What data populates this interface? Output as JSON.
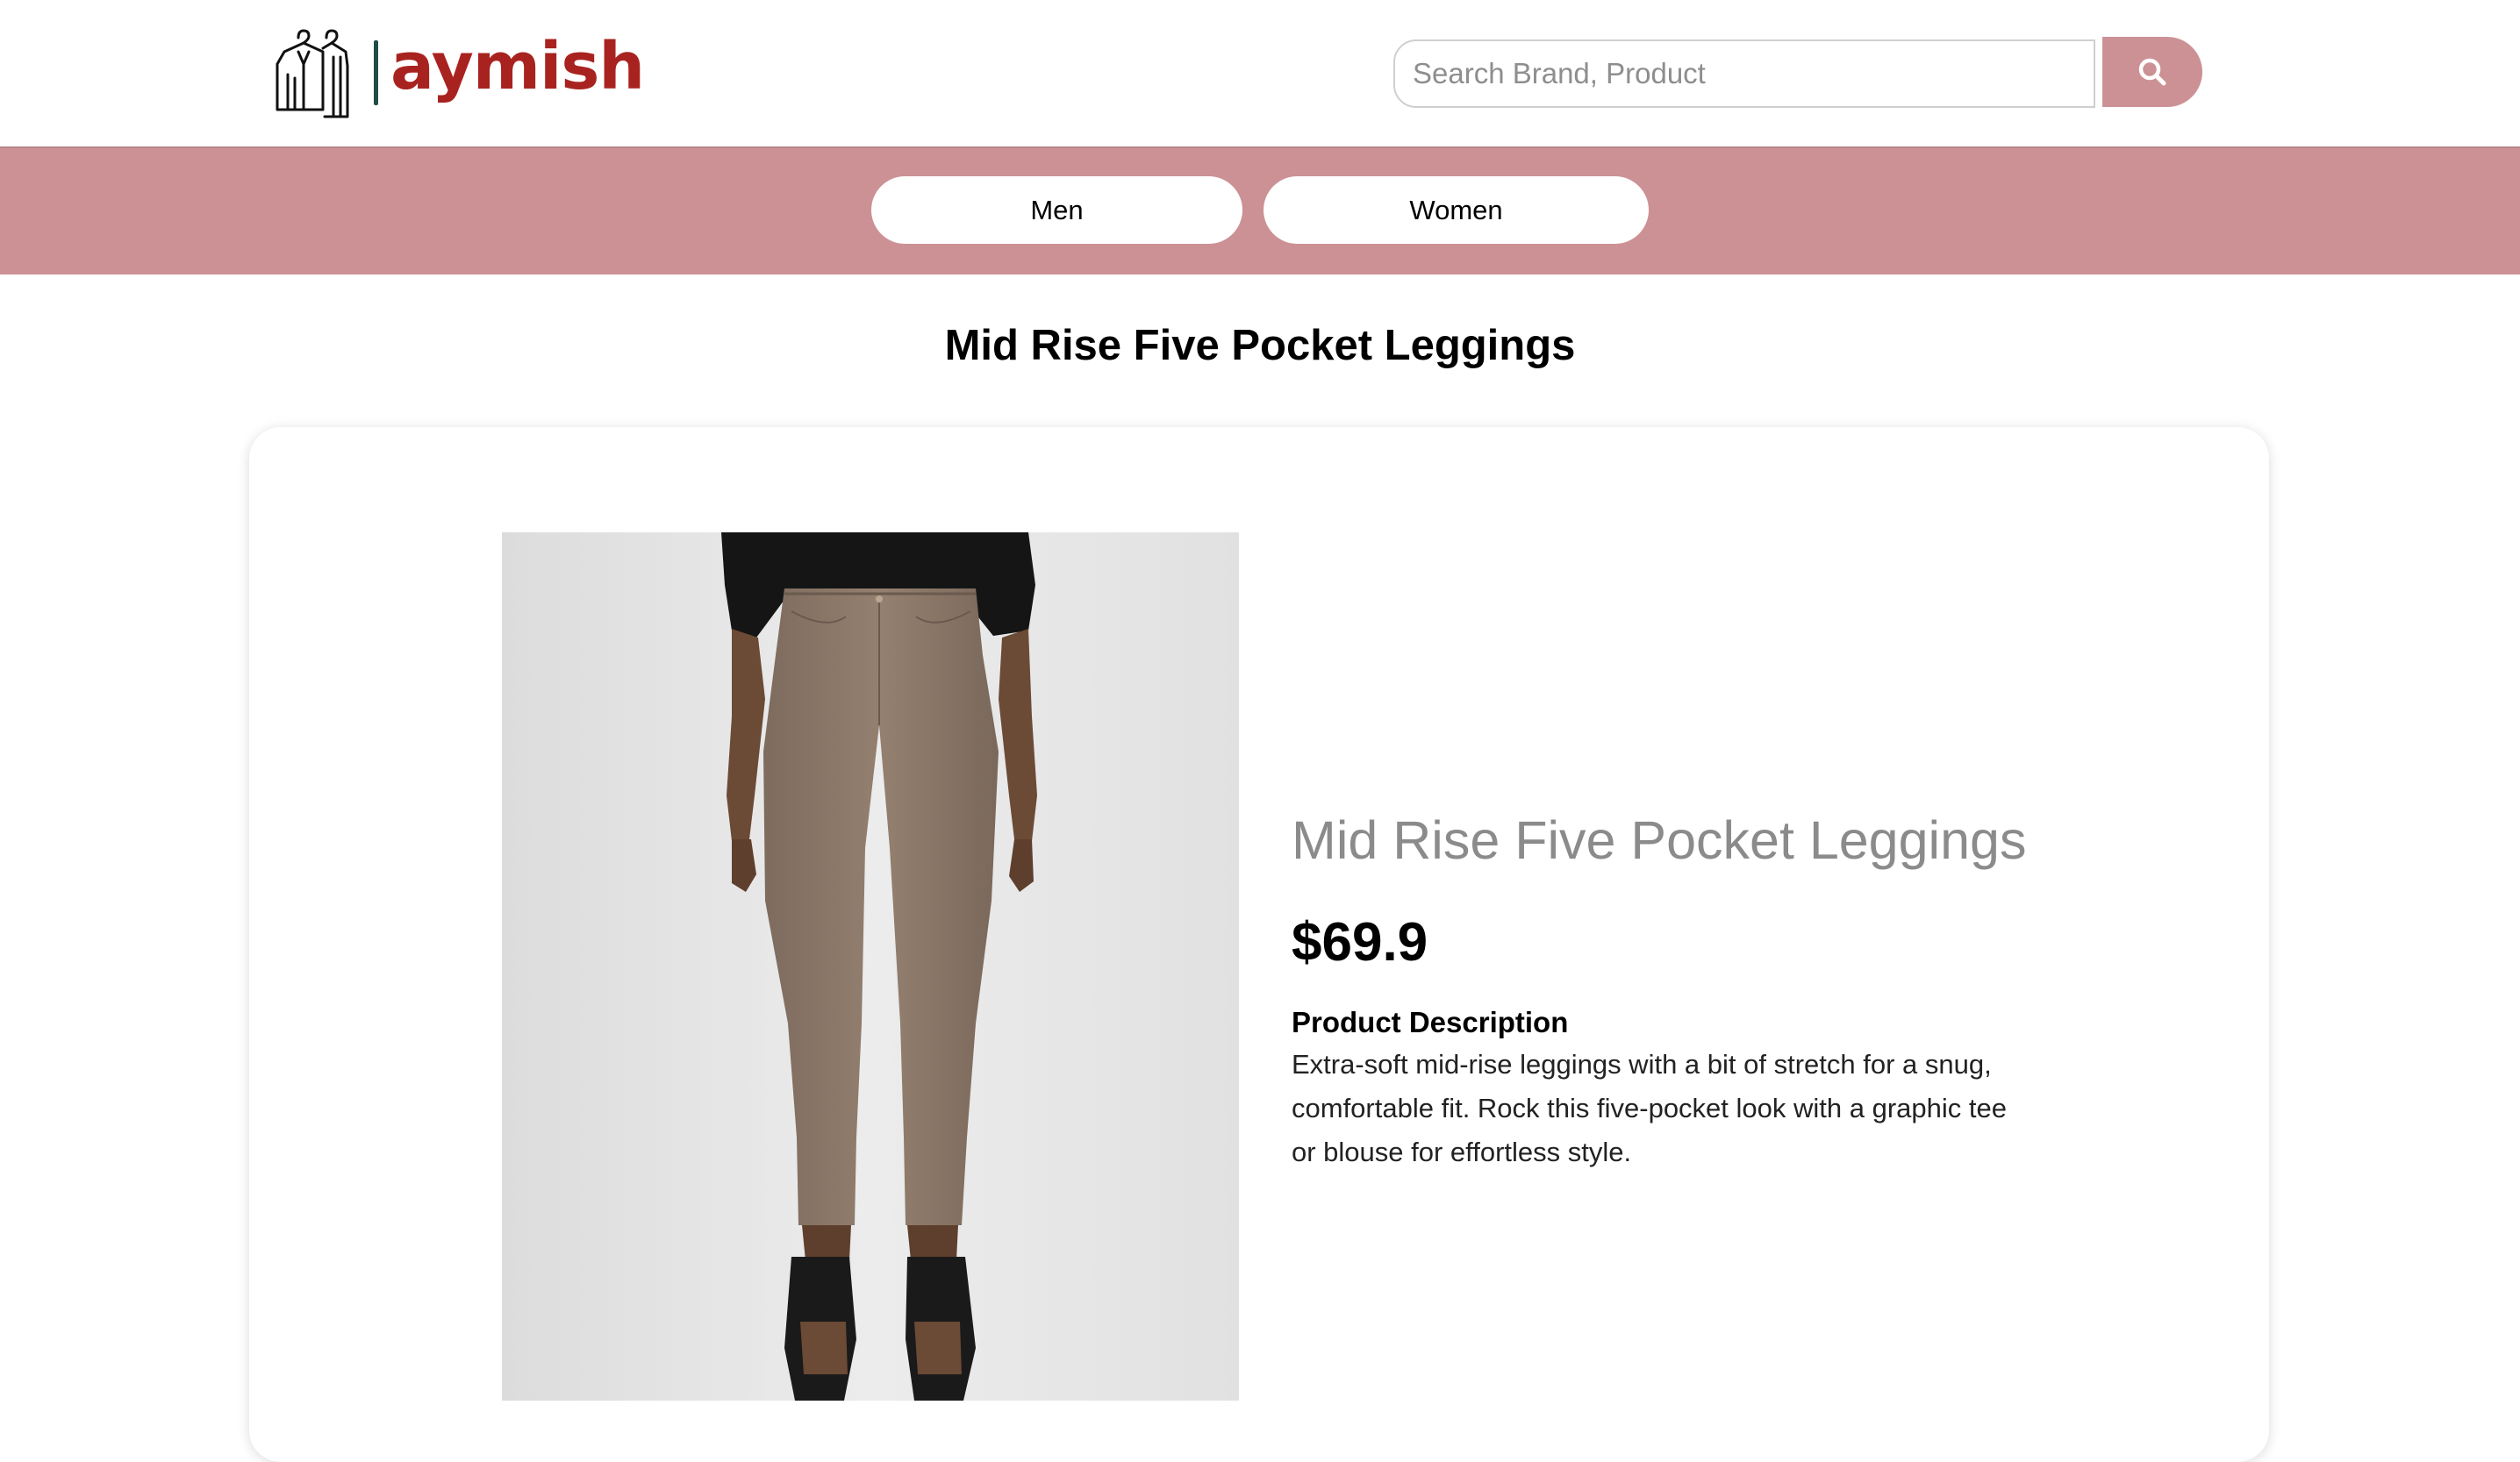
{
  "brand": {
    "name": "aymish",
    "color": "#a8231f"
  },
  "search": {
    "placeholder": "Search Brand, Product",
    "icon": "search-icon"
  },
  "nav": {
    "items": [
      {
        "label": "Men"
      },
      {
        "label": "Women"
      }
    ],
    "background": "#cc9194"
  },
  "page": {
    "title": "Mid Rise Five Pocket Leggings"
  },
  "product": {
    "name": "Mid Rise Five Pocket Leggings",
    "price": "$69.9",
    "description_heading": "Product Description",
    "description": "Extra-soft mid-rise leggings with a bit of stretch for a snug, comfortable fit. Rock this five-pocket look with a graphic tee or blouse for effortless style."
  }
}
